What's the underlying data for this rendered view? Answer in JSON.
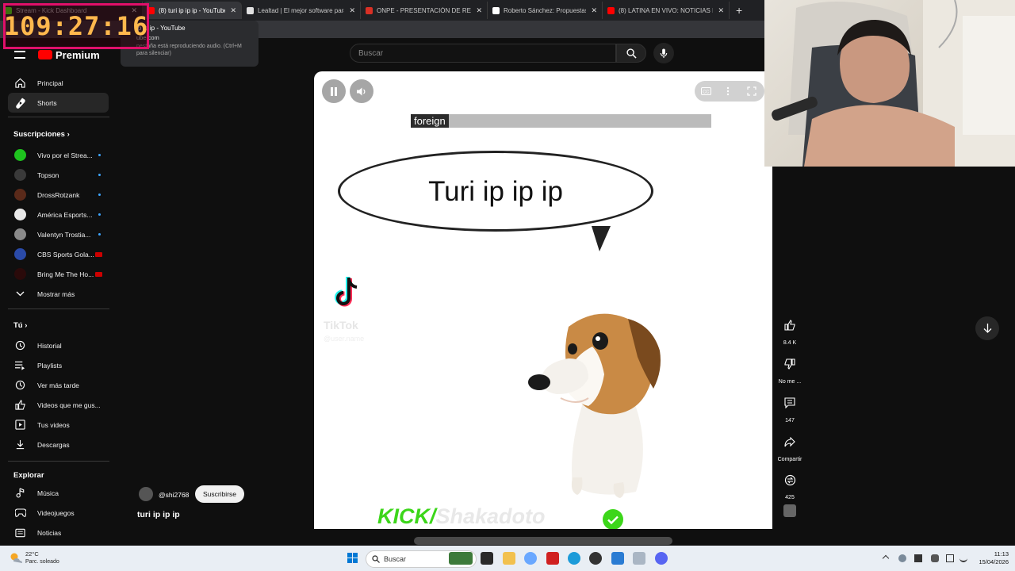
{
  "browser": {
    "tabs": [
      {
        "label": "Stream - Kick Dashboard",
        "color": "#53fc18"
      },
      {
        "label": "(8) turi ip ip ip - YouTube",
        "color": "#ff0000",
        "active": true
      },
      {
        "label": "Lealtad | El mejor software para p",
        "color": "#e0e0e0"
      },
      {
        "label": "ONPE - PRESENTACIÓN DE RESUL",
        "color": "#d93025"
      },
      {
        "label": "Roberto Sánchez: Propuestas",
        "color": "#ffffff"
      },
      {
        "label": "(8) LATINA EN VIVO: NOTICIAS DE",
        "color": "#ff0000"
      }
    ],
    "new_tab": "+"
  },
  "overlay": {
    "timer": "109:27:16"
  },
  "tooltip": {
    "title": "ip ip ip - YouTube",
    "domain": "ube.com",
    "note": "pestaña está reproduciendo audio. (Ctrl+M para silenciar)"
  },
  "header": {
    "logo": "Premium",
    "search_placeholder": "Buscar"
  },
  "sidebar": {
    "main": [
      {
        "label": "Principal",
        "icon": "home-icon"
      },
      {
        "label": "Shorts",
        "icon": "shorts-icon",
        "active": true
      }
    ],
    "subscriptions_title": "Suscripciones",
    "subscriptions": [
      {
        "label": "Vivo por el Strea...",
        "color": "#1ec31e",
        "badge": "dot"
      },
      {
        "label": "Topson",
        "color": "#3a3a3a",
        "badge": "dot"
      },
      {
        "label": "DrossRotzank",
        "color": "#5a2a1a",
        "badge": "dot"
      },
      {
        "label": "América Esports...",
        "color": "#e8e8e8",
        "badge": "dot"
      },
      {
        "label": "Valentyn Trostia...",
        "color": "#8a8a8a",
        "badge": "dot"
      },
      {
        "label": "CBS Sports Gola...",
        "color": "#2a4aa8",
        "badge": "live"
      },
      {
        "label": "Bring Me The Ho...",
        "color": "#2a0a0a",
        "badge": "live"
      }
    ],
    "show_more": "Mostrar más",
    "you_title": "Tú",
    "you": [
      {
        "label": "Historial",
        "icon": "history-icon"
      },
      {
        "label": "Playlists",
        "icon": "playlists-icon"
      },
      {
        "label": "Ver más tarde",
        "icon": "watch-later-icon"
      },
      {
        "label": "Videos que me gus...",
        "icon": "liked-icon"
      },
      {
        "label": "Tus videos",
        "icon": "your-videos-icon"
      },
      {
        "label": "Descargas",
        "icon": "downloads-icon"
      }
    ],
    "explore_title": "Explorar",
    "explore": [
      {
        "label": "Música",
        "icon": "music-icon"
      },
      {
        "label": "Videojuegos",
        "icon": "gaming-icon"
      },
      {
        "label": "Noticias",
        "icon": "news-icon"
      }
    ]
  },
  "video": {
    "caption": "foreign",
    "bubble_text": "Turi ip ip ip",
    "tiktok_name": "TikTok",
    "tiktok_user": "@user.name",
    "watermark_kick": "KICK/",
    "watermark_user": "Shakadoto"
  },
  "channel": {
    "handle": "@shi2768",
    "subscribe": "Suscribirse",
    "title": "turi ip ip ip"
  },
  "actions": {
    "like": "8.4 K",
    "dislike": "No me ...",
    "comments": "147",
    "share": "Compartir",
    "remix": "425"
  },
  "taskbar": {
    "temperature": "22°C",
    "weather": "Parc. soleado",
    "search": "Buscar",
    "time": "11:13",
    "date": "15/04/2026"
  }
}
